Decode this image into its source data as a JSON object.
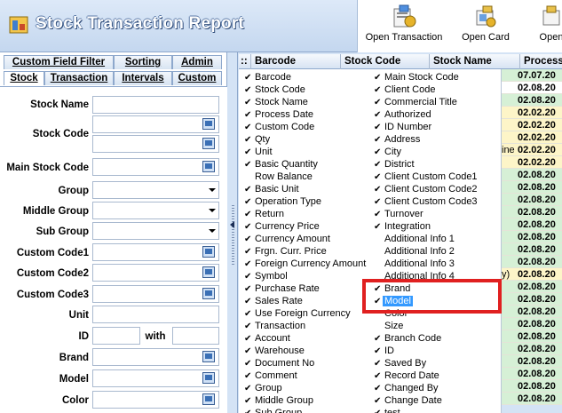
{
  "app": {
    "title": "Stock Transaction Report"
  },
  "ribbon": {
    "buttons": [
      {
        "label": "Open Transaction",
        "icon": "open-transaction-icon"
      },
      {
        "label": "Open Card",
        "icon": "open-card-icon"
      },
      {
        "label": "Open",
        "icon": "open-icon"
      }
    ]
  },
  "tabs": {
    "row1": [
      "Custom Field Filter",
      "Sorting",
      "Admin"
    ],
    "row2": [
      "Stock",
      "Transaction",
      "Intervals",
      "Custom"
    ],
    "active": "Stock"
  },
  "filters": {
    "stock_name": "Stock Name",
    "stock_code": "Stock Code",
    "main_stock_code": "Main Stock Code",
    "group": "Group",
    "middle_group": "Middle Group",
    "sub_group": "Sub Group",
    "custom_code1": "Custom Code1",
    "custom_code2": "Custom Code2",
    "custom_code3": "Custom Code3",
    "unit": "Unit",
    "id": "ID",
    "with": "with",
    "brand": "Brand",
    "model": "Model",
    "color": "Color"
  },
  "grid": {
    "headers": [
      "Barcode",
      "Stock Code",
      "Stock Name",
      "Process"
    ]
  },
  "chooser": {
    "col1": [
      {
        "label": "Barcode",
        "checked": true
      },
      {
        "label": "Stock Code",
        "checked": true
      },
      {
        "label": "Stock Name",
        "checked": true
      },
      {
        "label": "Process Date",
        "checked": true
      },
      {
        "label": "Custom Code",
        "checked": true
      },
      {
        "label": "Qty",
        "checked": true
      },
      {
        "label": "Unit",
        "checked": true
      },
      {
        "label": "Basic Quantity",
        "checked": true
      },
      {
        "label": "Row Balance",
        "checked": false
      },
      {
        "label": "Basic Unit",
        "checked": true
      },
      {
        "label": "Operation Type",
        "checked": true
      },
      {
        "label": "Return",
        "checked": true
      },
      {
        "label": "Currency Price",
        "checked": true
      },
      {
        "label": "Currency Amount",
        "checked": true
      },
      {
        "label": "Frgn. Curr. Price",
        "checked": true
      },
      {
        "label": "Foreign Currency Amount",
        "checked": true
      },
      {
        "label": "Symbol",
        "checked": true
      },
      {
        "label": "Purchase Rate",
        "checked": true
      },
      {
        "label": "Sales Rate",
        "checked": true
      },
      {
        "label": "Use Foreign Currency",
        "checked": true
      },
      {
        "label": "Transaction",
        "checked": true
      },
      {
        "label": "Account",
        "checked": true
      },
      {
        "label": "Warehouse",
        "checked": true
      },
      {
        "label": "Document No",
        "checked": true
      },
      {
        "label": "Comment",
        "checked": true
      },
      {
        "label": "Group",
        "checked": true
      },
      {
        "label": "Middle Group",
        "checked": true
      },
      {
        "label": "Sub Group",
        "checked": true
      }
    ],
    "col2": [
      {
        "label": "Main Stock Code",
        "checked": true
      },
      {
        "label": "Client Code",
        "checked": true
      },
      {
        "label": "Commercial Title",
        "checked": true
      },
      {
        "label": "Authorized",
        "checked": true
      },
      {
        "label": "ID Number",
        "checked": true
      },
      {
        "label": "Address",
        "checked": true
      },
      {
        "label": "City",
        "checked": true
      },
      {
        "label": "District",
        "checked": true
      },
      {
        "label": "Client Custom Code1",
        "checked": true
      },
      {
        "label": "Client Custom Code2",
        "checked": true
      },
      {
        "label": "Client Custom Code3",
        "checked": true
      },
      {
        "label": "Turnover",
        "checked": true
      },
      {
        "label": "Integration",
        "checked": true
      },
      {
        "label": "Additional Info 1",
        "checked": false
      },
      {
        "label": "Additional Info 2",
        "checked": false
      },
      {
        "label": "Additional Info 3",
        "checked": false
      },
      {
        "label": "Additional Info 4",
        "checked": false
      },
      {
        "label": "Brand",
        "checked": true
      },
      {
        "label": "Model",
        "checked": true,
        "selected": true
      },
      {
        "label": "Color",
        "checked": false
      },
      {
        "label": "Size",
        "checked": false
      },
      {
        "label": "Branch Code",
        "checked": true
      },
      {
        "label": "ID",
        "checked": true
      },
      {
        "label": "Saved By",
        "checked": true
      },
      {
        "label": "Record Date",
        "checked": true
      },
      {
        "label": "Changed By",
        "checked": true
      },
      {
        "label": "Change Date",
        "checked": true
      },
      {
        "label": "test",
        "checked": true
      }
    ]
  },
  "process_rows": [
    {
      "text": "07.07.20",
      "bg": "#d6f0d6"
    },
    {
      "text": "02.08.20",
      "bg": "#fff"
    },
    {
      "text": "02.08.20",
      "bg": "#d6f0d6"
    },
    {
      "text": "02.02.20",
      "bg": "#fdf5c8"
    },
    {
      "text": "02.02.20",
      "bg": "#fdf5c8"
    },
    {
      "text": "02.02.20",
      "bg": "#fdf5c8"
    },
    {
      "text": "02.02.20",
      "bg": "#fdf5c8",
      "prefix": "ine"
    },
    {
      "text": "02.02.20",
      "bg": "#fdf5c8"
    },
    {
      "text": "02.08.20",
      "bg": "#d6f0d6"
    },
    {
      "text": "02.08.20",
      "bg": "#d6f0d6"
    },
    {
      "text": "02.08.20",
      "bg": "#d6f0d6"
    },
    {
      "text": "02.08.20",
      "bg": "#d6f0d6"
    },
    {
      "text": "02.08.20",
      "bg": "#d6f0d6"
    },
    {
      "text": "02.08.20",
      "bg": "#d6f0d6"
    },
    {
      "text": "02.08.20",
      "bg": "#d6f0d6"
    },
    {
      "text": "02.08.20",
      "bg": "#d6f0d6"
    },
    {
      "text": "02.08.20",
      "bg": "#fdf5c8",
      "prefix": "y)"
    },
    {
      "text": "02.08.20",
      "bg": "#d6f0d6"
    },
    {
      "text": "02.08.20",
      "bg": "#d6f0d6"
    },
    {
      "text": "02.08.20",
      "bg": "#d6f0d6"
    },
    {
      "text": "02.08.20",
      "bg": "#d6f0d6"
    },
    {
      "text": "02.08.20",
      "bg": "#d6f0d6"
    },
    {
      "text": "02.08.20",
      "bg": "#d6f0d6"
    },
    {
      "text": "02.08.20",
      "bg": "#d6f0d6"
    },
    {
      "text": "02.08.20",
      "bg": "#d6f0d6"
    },
    {
      "text": "02.08.20",
      "bg": "#d6f0d6"
    },
    {
      "text": "02.08.20",
      "bg": "#d6f0d6"
    }
  ]
}
